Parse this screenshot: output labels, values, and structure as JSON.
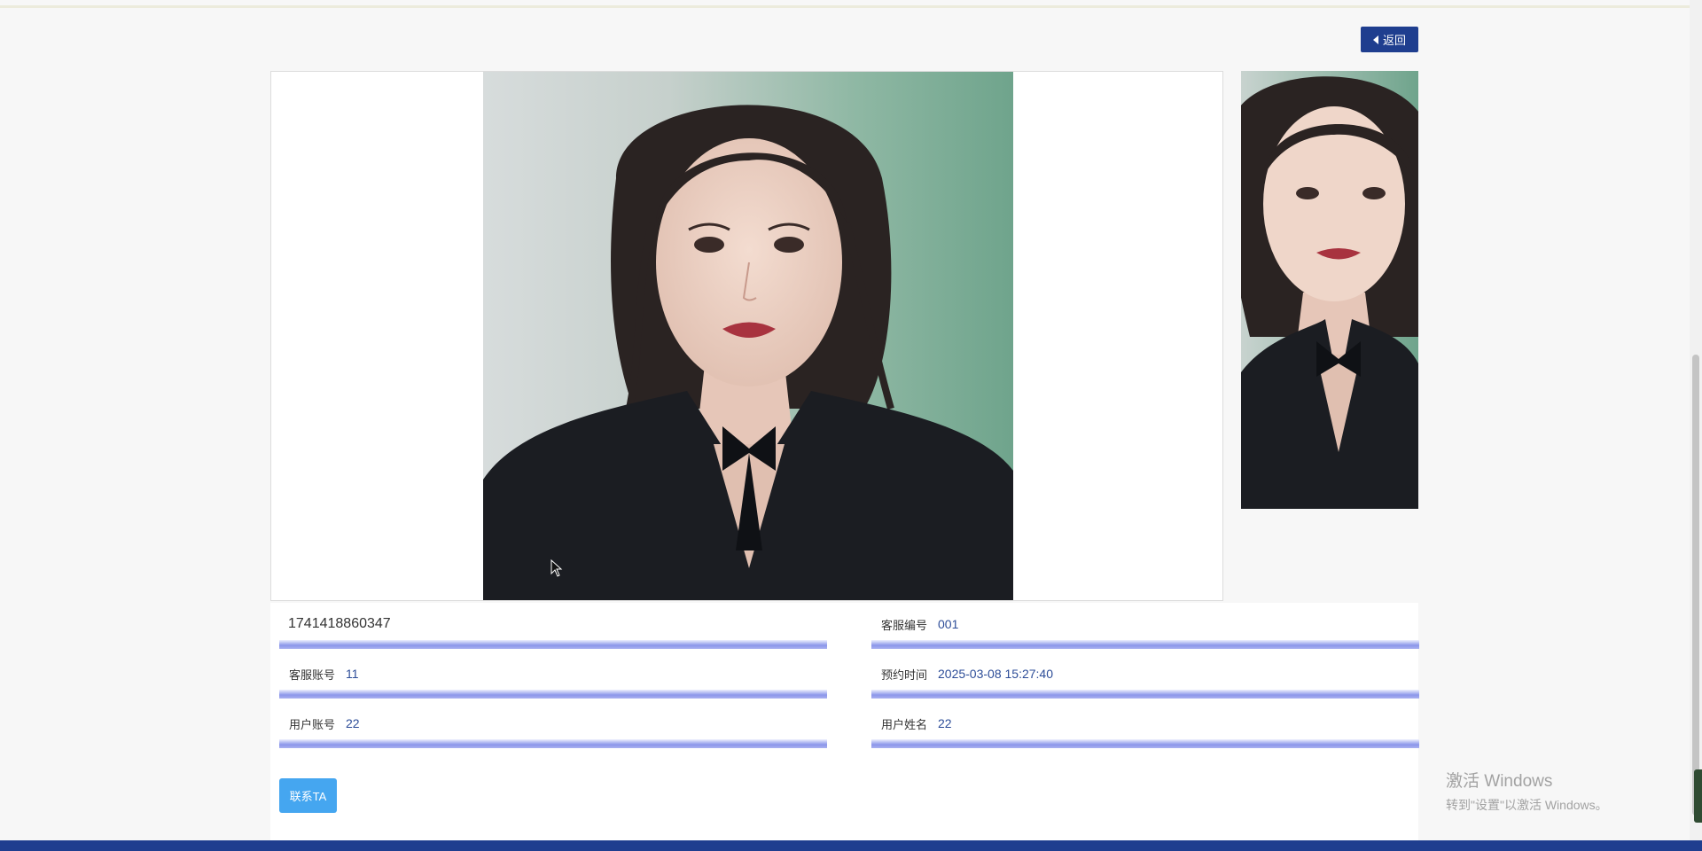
{
  "header": {
    "back_label": "返回"
  },
  "images": {
    "main_alt": "",
    "thumb_alt": ""
  },
  "record": {
    "id": "1741418860347",
    "fields": [
      {
        "label": "客服编号",
        "value": "001"
      },
      {
        "label": "客服账号",
        "value": "11"
      },
      {
        "label": "预约时间",
        "value": "2025-03-08 15:27:40"
      },
      {
        "label": "用户账号",
        "value": "22"
      },
      {
        "label": "用户姓名",
        "value": "22"
      }
    ]
  },
  "actions": {
    "contact_label": "联系TA"
  },
  "watermark": {
    "title": "激活 Windows",
    "subtitle": "转到\"设置\"以激活 Windows。"
  },
  "colors": {
    "primary": "#1f3e8f",
    "button": "#45a6f0",
    "value_text": "#2d4d98",
    "underline": "#8b96ea"
  },
  "icons": {
    "back": "caret-left-icon",
    "cursor": "mouse-pointer-icon"
  }
}
